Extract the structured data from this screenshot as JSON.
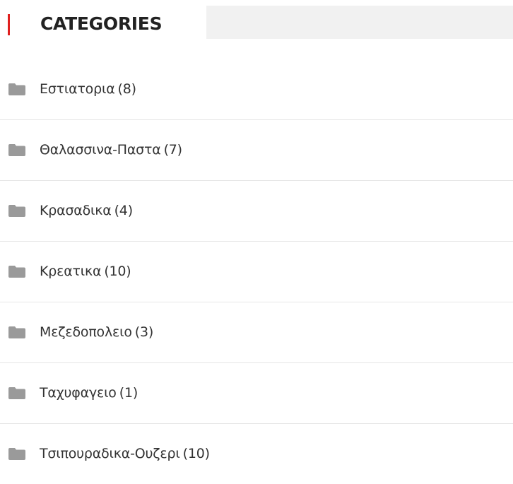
{
  "widget": {
    "title": "CATEGORIES",
    "accent_color": "#e0201f",
    "icon": "folder-icon"
  },
  "categories": [
    {
      "label": "Εστιατορια",
      "count": "(8)"
    },
    {
      "label": "Θαλασσινα-Παστα",
      "count": "(7)"
    },
    {
      "label": "Κρασαδικα",
      "count": "(4)"
    },
    {
      "label": "Κρεατικα",
      "count": "(10)"
    },
    {
      "label": "Μεζεδοπολειο",
      "count": "(3)"
    },
    {
      "label": "Ταχυφαγειο",
      "count": "(1)"
    },
    {
      "label": "Τσιπουραδικα-Ουζερι",
      "count": "(10)"
    }
  ]
}
